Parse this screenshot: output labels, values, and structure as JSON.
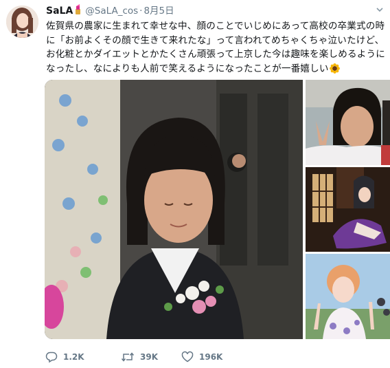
{
  "user": {
    "display_name": "SaLA",
    "handle": "@SaLA_cos",
    "separator": "·",
    "date": "8月5日"
  },
  "tweet": {
    "lines": [
      "佐賀県の農家に生まれて幸せな中、顔のことでいじめにあって高校の卒業式の時",
      "に「お前よくその顔で生きて来れたな」って言われてめちゃくちゃ泣いたけど、",
      "お化粧とかダイエットとかたくさん頑張って上京した今は趣味を楽しめるように",
      "なったし、なによりも人前で笑えるようになったことが一番嬉しい"
    ],
    "emoji": "sunflower"
  },
  "media": {
    "count": 4
  },
  "actions": {
    "reply_count": "1.2K",
    "retweet_count": "39K",
    "like_count": "196K"
  },
  "icons": {
    "name_emoji": "lipstick-icon",
    "more": "chevron-down-icon",
    "reply": "reply-icon",
    "retweet": "retweet-icon",
    "like": "heart-icon"
  },
  "colors": {
    "text": "#14171a",
    "secondary": "#657786",
    "background": "#ffffff"
  }
}
